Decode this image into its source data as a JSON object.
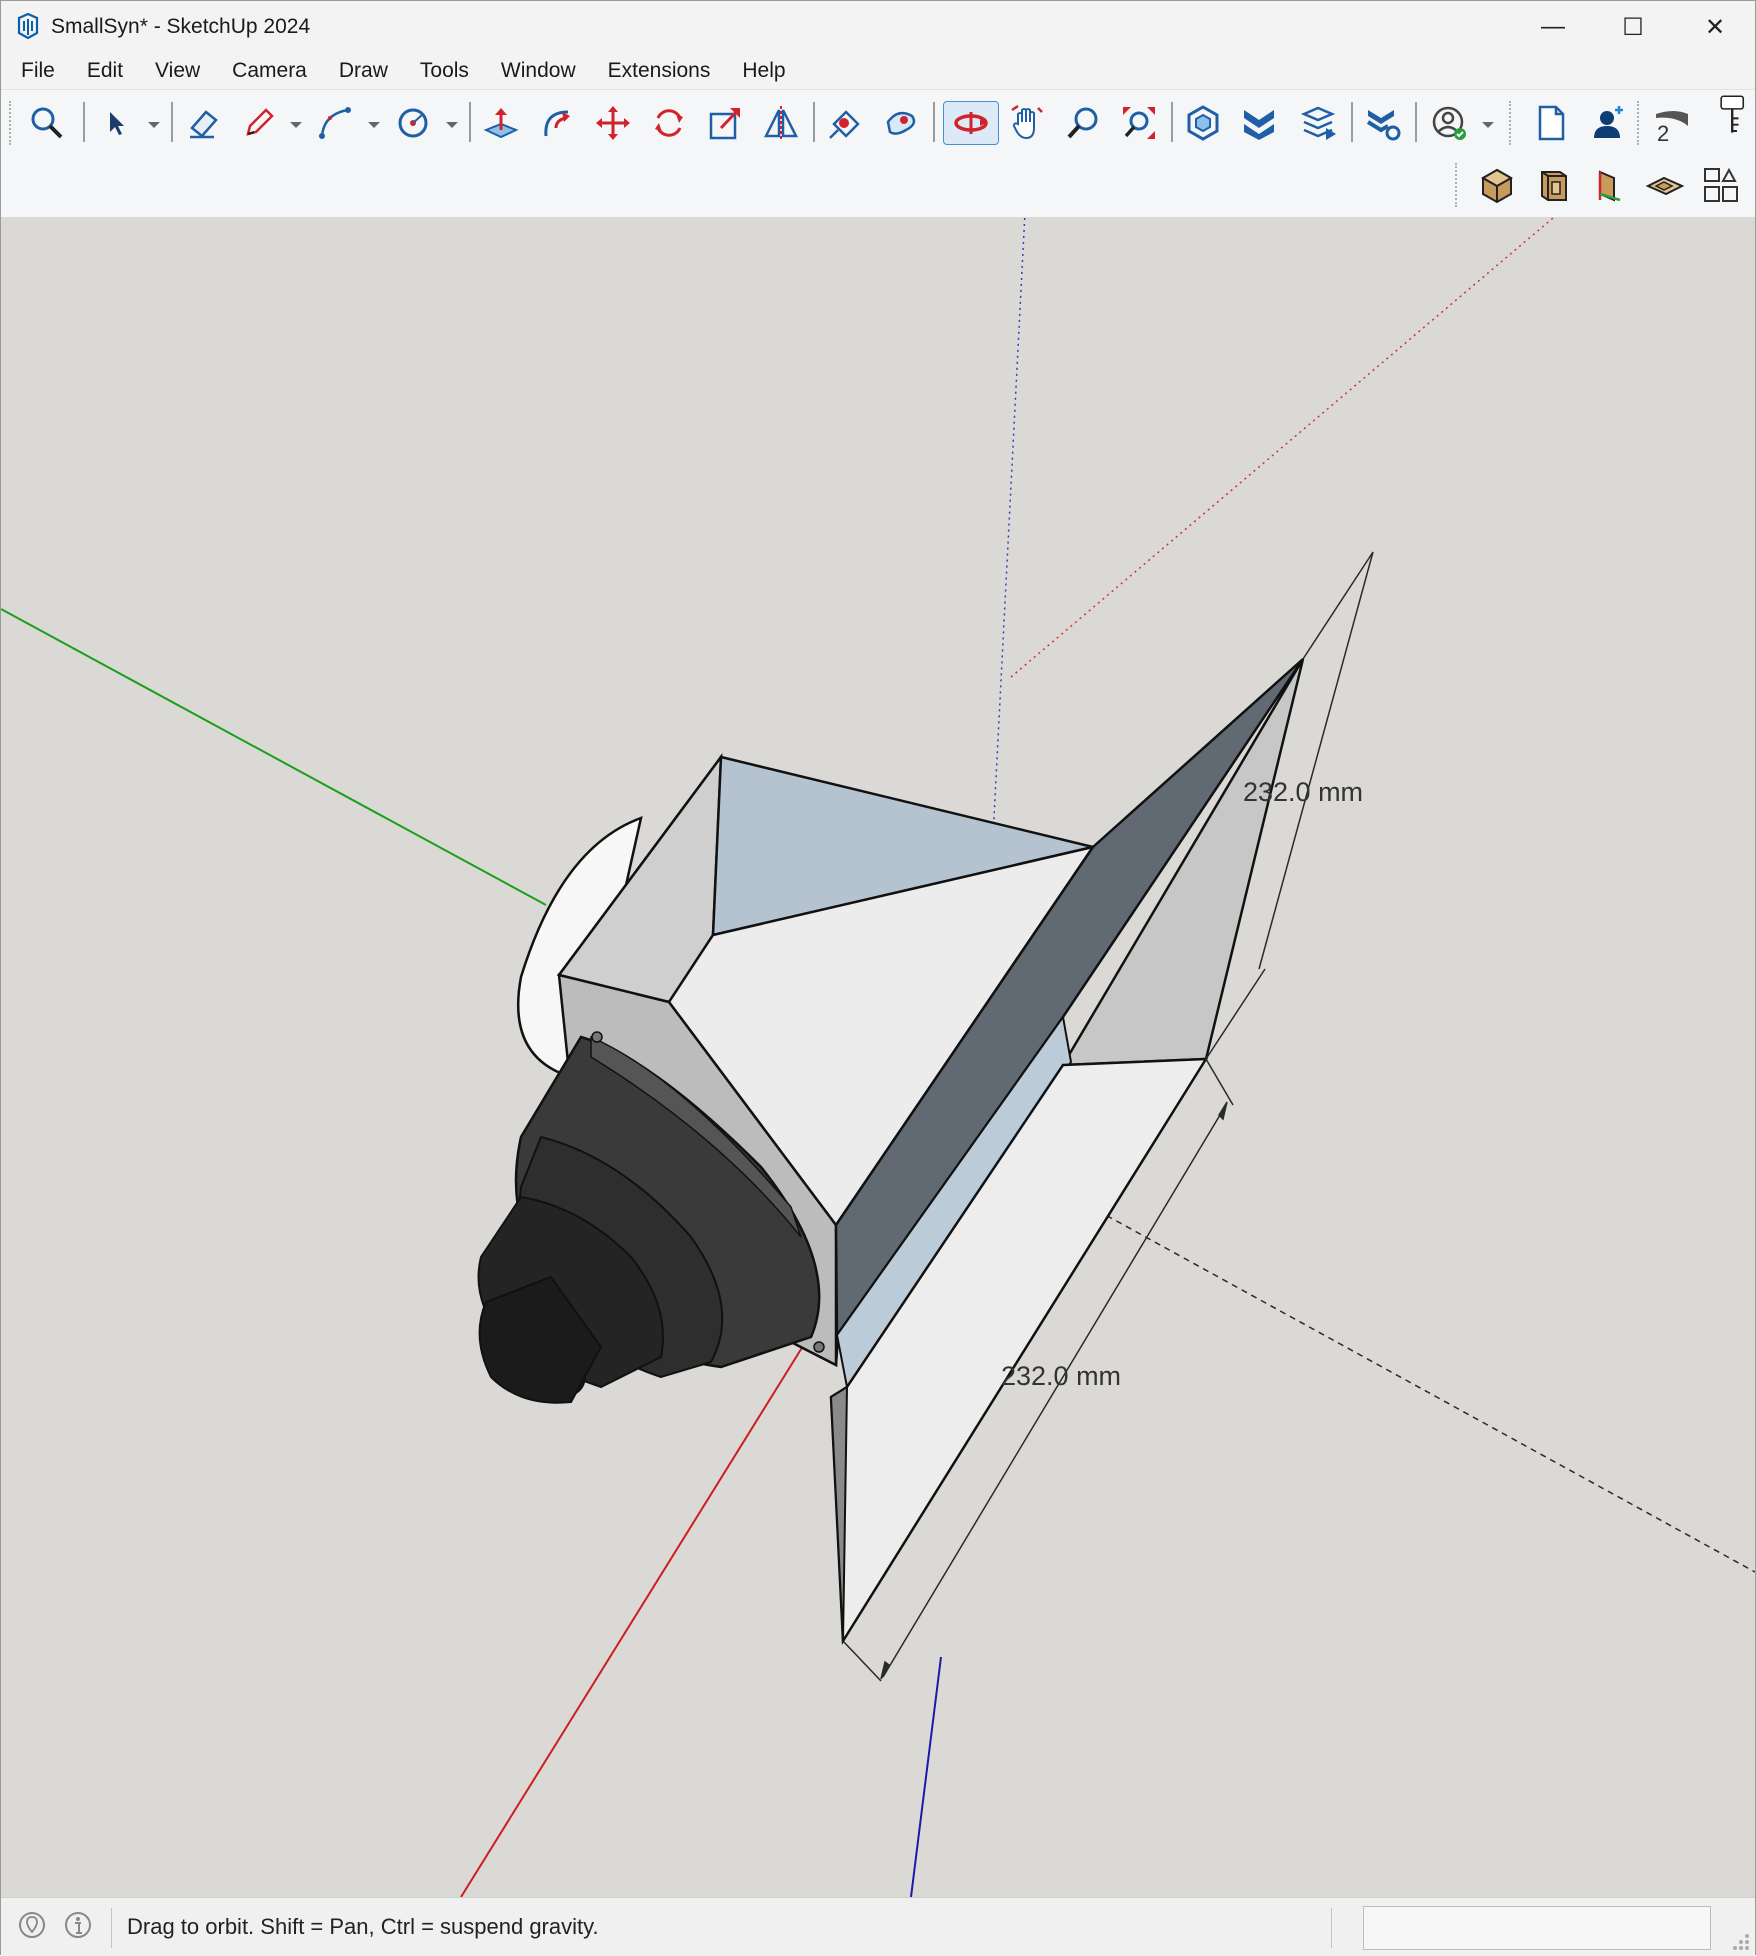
{
  "window": {
    "title": "SmallSyn* - SketchUp 2024",
    "controls": {
      "minimize": "—",
      "maximize": "☐",
      "close": "✕"
    }
  },
  "menu": [
    "File",
    "Edit",
    "View",
    "Camera",
    "Draw",
    "Tools",
    "Window",
    "Extensions",
    "Help"
  ],
  "toolbar": {
    "tools": [
      "search-icon",
      "select-icon",
      "eraser-icon",
      "pencil-icon",
      "arc-icon",
      "circle-icon",
      "push-pull-icon",
      "follow-me-icon",
      "move-icon",
      "rotate-icon",
      "scale-icon",
      "flip-icon",
      "paint-bucket-icon",
      "sample-paint-icon",
      "orbit-icon",
      "pan-icon",
      "zoom-icon",
      "zoom-extents-icon",
      "warehouse-icon",
      "extension-warehouse-icon",
      "layout-icon",
      "extension-manager-icon",
      "user-account-icon",
      "new-file-icon",
      "profile-add-icon",
      "instructor-icon",
      "tool-key-icon"
    ],
    "active_tool": "orbit-icon",
    "instructor_badge": "2",
    "views": [
      "iso-view-icon",
      "front-view-icon",
      "side-view-icon",
      "top-view-icon",
      "views-grid-icon"
    ]
  },
  "viewport": {
    "dimensions": [
      "232.0 mm",
      "232.0 mm"
    ],
    "colors": {
      "background": "#dbd9d5",
      "red_axis": "#cc1f1f",
      "green_axis": "#1a9f1a",
      "blue_axis": "#1a1aa8"
    }
  },
  "status": {
    "hint": "Drag to orbit. Shift = Pan, Ctrl = suspend gravity.",
    "measurements_value": ""
  }
}
